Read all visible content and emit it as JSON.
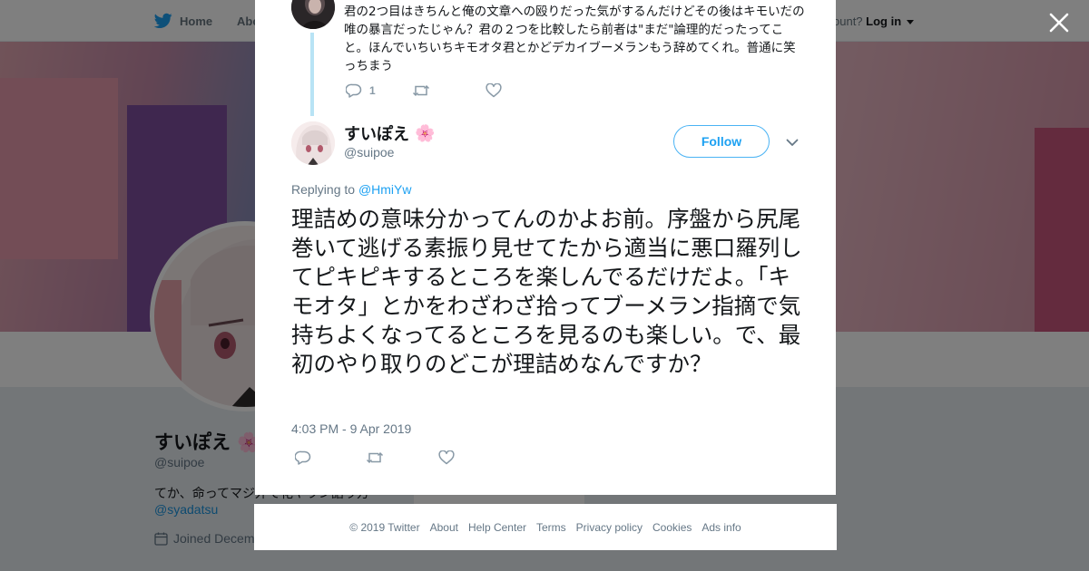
{
  "topbar": {
    "home_label": "Home",
    "about_label": "Abo",
    "account_text": "ccount?",
    "login_label": "Log in"
  },
  "profile": {
    "name": "すいぽえ",
    "handle": "@suipoe",
    "bio": "てか、命ってマジ外で花ヤラン語り方",
    "bio_mention": "@syadatsu",
    "joined": "Joined Decem"
  },
  "previous_tweet": {
    "text": "君の2つ目はきちんと俺の文章への殴りだった気がするんだけどその後はキモいだの唯の暴言だったじゃん？君の２つを比較したら前者は\"まだ\"論理的だったってこと。ほんでいちいちキモオタ君とかどデカイブーメランもう辞めてくれ。普通に笑っちまう",
    "reply_count": "1"
  },
  "tweet": {
    "author_name": "すいぽえ",
    "author_handle": "@suipoe",
    "follow_label": "Follow",
    "replying_prefix": "Replying to",
    "replying_to": "@HmiYw",
    "text": "理詰めの意味分かってんのかよお前。序盤から尻尾巻いて逃げる素振り見せてたから適当に悪口羅列してピキピキするところを楽しんでるだけだよ。「キモオタ」とかをわざわざ拾ってブーメラン指摘で気持ちよくなってるところを見るのも楽しい。で、最初のやり取りのどこが理詰めなんですか？",
    "timestamp": "4:03 PM - 9 Apr 2019"
  },
  "footer": {
    "links": [
      "© 2019 Twitter",
      "About",
      "Help Center",
      "Terms",
      "Privacy policy",
      "Cookies",
      "Ads info"
    ]
  },
  "colors": {
    "brand": "#1da1f2",
    "thread_line": "#b8e3f5",
    "text_primary": "#14171a",
    "text_secondary": "#657786",
    "icon_gray": "#8899a6"
  },
  "icons": {
    "logo": "twitter-bird-icon",
    "close": "close-icon",
    "reply": "reply-icon",
    "retweet": "retweet-icon",
    "like": "heart-icon",
    "caret": "chevron-down-icon",
    "emoji": "cherry-blossom-icon",
    "calendar": "calendar-icon"
  }
}
